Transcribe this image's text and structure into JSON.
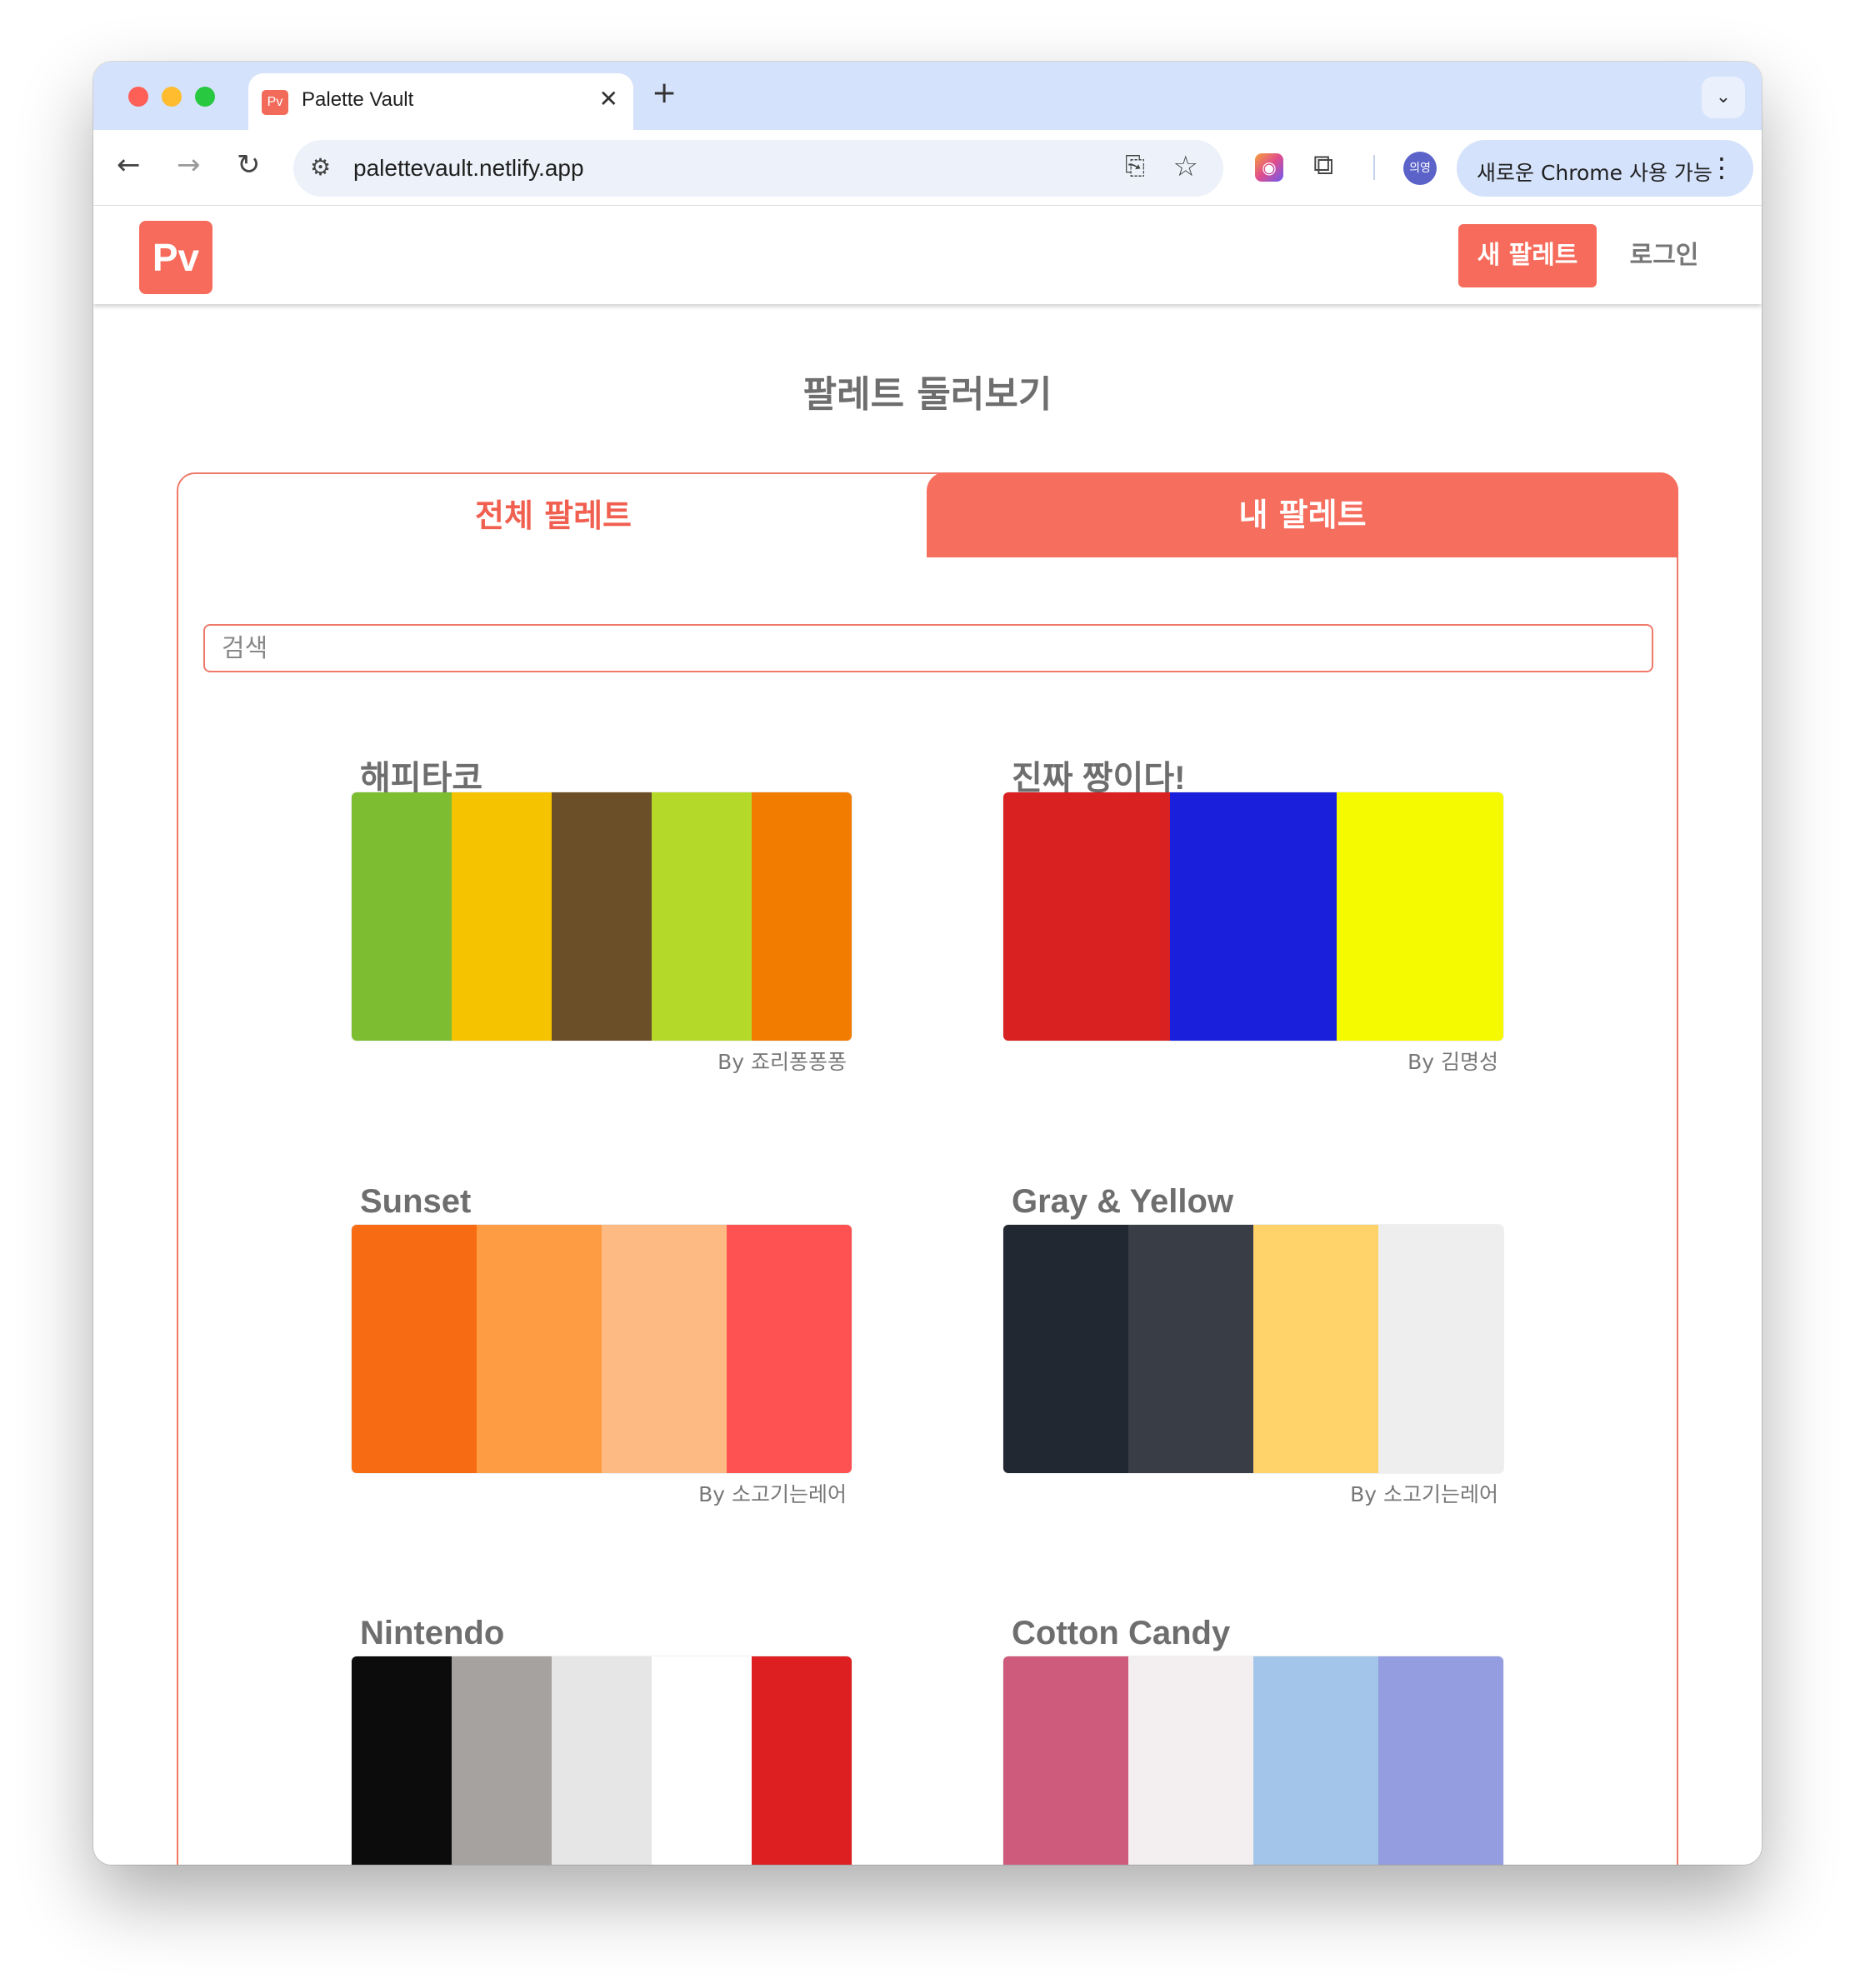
{
  "browser": {
    "tab_favicon": "Pv",
    "tab_title": "Palette Vault",
    "tab_close": "✕",
    "new_tab": "+",
    "url": "palettevault.netlify.app",
    "profile_initials": "의영",
    "chrome_promo": "새로운 Chrome 사용 가능"
  },
  "header": {
    "logo": "Pv",
    "new_palette_button": "새 팔레트",
    "login_link": "로그인"
  },
  "page_title": "팔레트 둘러보기",
  "tabs": {
    "all": "전체 팔레트",
    "mine": "내 팔레트"
  },
  "search": {
    "placeholder": "검색",
    "value": ""
  },
  "palettes": [
    {
      "title": "해피타코",
      "author": "By 죠리퐁퐁퐁",
      "colors": [
        "#7cbd31",
        "#f6c300",
        "#6b4f28",
        "#b5d929",
        "#f27c00"
      ]
    },
    {
      "title": "진짜 짱이다!",
      "author": "By 김명성",
      "colors": [
        "#d92121",
        "#1a1fdc",
        "#f6fa00"
      ]
    },
    {
      "title": "Sunset",
      "author": "By 소고기는레어",
      "colors": [
        "#f76c12",
        "#fd9c42",
        "#fdba82",
        "#fd5251"
      ]
    },
    {
      "title": "Gray & Yellow",
      "author": "By 소고기는레어",
      "colors": [
        "#222831",
        "#393e46",
        "#ffd369",
        "#eeeeee"
      ]
    },
    {
      "title": "Nintendo",
      "author": "",
      "colors": [
        "#0c0c0c",
        "#a6a2a0",
        "#e6e6e6",
        "#ffffff",
        "#dd1f21"
      ]
    },
    {
      "title": "Cotton Candy",
      "author": "",
      "colors": [
        "#cf5b7c",
        "#f3eef0",
        "#a4c5ea",
        "#939ddf"
      ]
    }
  ],
  "colors": {
    "accent": "#f66b5b",
    "tab_bar": "#d4e2fb",
    "text_gray": "#6e6e6e"
  }
}
